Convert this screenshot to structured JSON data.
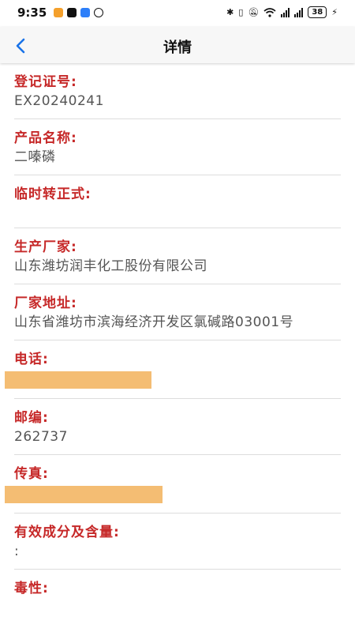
{
  "status_bar": {
    "time": "9:35",
    "battery": "38"
  },
  "nav": {
    "title": "详情"
  },
  "fields": [
    {
      "label": "登记证号:",
      "value": "EX20240241"
    },
    {
      "label": "产品名称:",
      "value": "二嗪磷"
    },
    {
      "label": "临时转正式:",
      "value": ""
    },
    {
      "label": "生产厂家:",
      "value": "山东潍坊润丰化工股份有限公司"
    },
    {
      "label": "厂家地址:",
      "value": "山东省潍坊市滨海经济开发区氯碱路03001号"
    },
    {
      "label": "电话:",
      "value": ""
    },
    {
      "label": "邮编:",
      "value": "262737"
    },
    {
      "label": "传真:",
      "value": ""
    },
    {
      "label": "有效成分及含量:",
      "value": ":"
    },
    {
      "label": "毒性:",
      "value": ""
    }
  ],
  "colors": {
    "label": "#c62828",
    "value": "#555555",
    "back_arrow": "#1a73e8",
    "redaction": "#f4bd73"
  }
}
